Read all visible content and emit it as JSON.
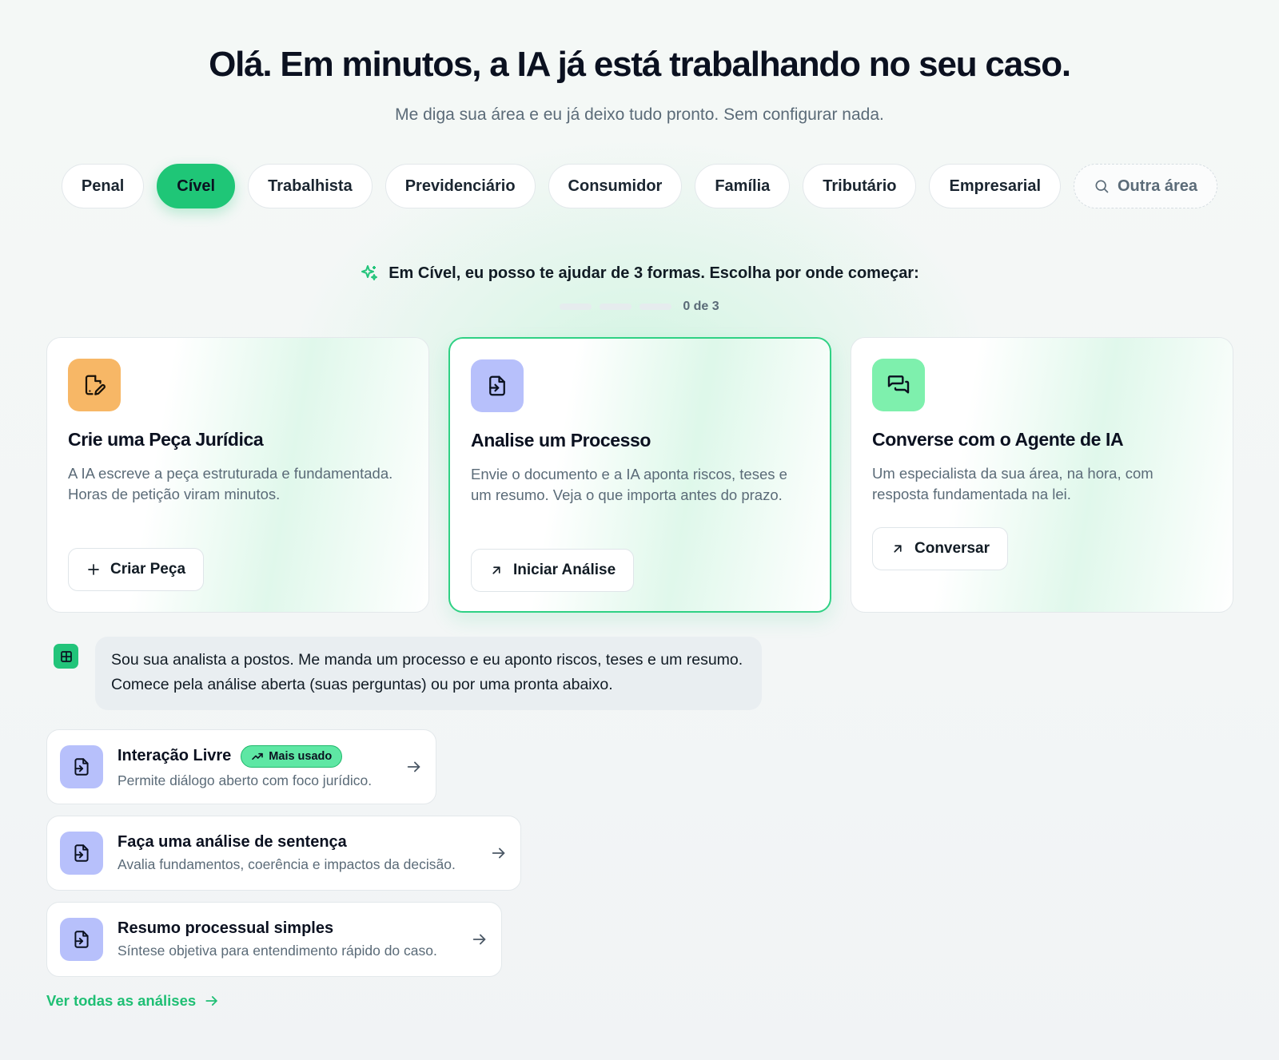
{
  "hero": {
    "title": "Olá. Em minutos, a IA já está trabalhando no seu caso.",
    "subtitle": "Me diga sua área e eu já deixo tudo pronto. Sem configurar nada."
  },
  "areas": {
    "items": [
      "Penal",
      "Cível",
      "Trabalhista",
      "Previdenciário",
      "Consumidor",
      "Família",
      "Tributário",
      "Empresarial"
    ],
    "active": "Cível",
    "other_label": "Outra área"
  },
  "prompt": {
    "text": "Em Cível, eu posso te ajudar de 3 formas. Escolha por onde começar:",
    "progress_label": "0 de 3",
    "progress_value": 0,
    "progress_total": 3
  },
  "cards": [
    {
      "title": "Crie uma Peça Jurídica",
      "description": "A IA escreve a peça estruturada e fundamentada. Horas de petição viram minutos.",
      "button": "Criar Peça",
      "icon": "file-edit-icon",
      "icon_color": "#f7b766"
    },
    {
      "title": "Analise um Processo",
      "description": "Envie o documento e a IA aponta riscos, teses e um resumo. Veja o que importa antes do prazo.",
      "button": "Iniciar Análise",
      "icon": "file-import-icon",
      "icon_color": "#b7c0fb"
    },
    {
      "title": "Converse com o Agente de IA",
      "description": "Um especialista da sua área, na hora, com resposta fundamentada na lei.",
      "button": "Conversar",
      "icon": "chat-icon",
      "icon_color": "#7ef0ad"
    }
  ],
  "assistant": {
    "message": "Sou sua analista a postos. Me manda um processo e eu aponto riscos, teses e um resumo. Comece pela análise aberta (suas perguntas) ou por uma pronta abaixo."
  },
  "analyses": [
    {
      "title": "Interação Livre",
      "badge": "Mais usado",
      "subtitle": "Permite diálogo aberto com foco jurídico."
    },
    {
      "title": "Faça uma análise de sentença",
      "subtitle": "Avalia fundamentos, coerência e impactos da decisão."
    },
    {
      "title": "Resumo processual simples",
      "subtitle": "Síntese objetiva para entendimento rápido do caso."
    }
  ],
  "see_all": "Ver todas as análises",
  "colors": {
    "accent": "#1fc677",
    "accent_text": "#1fbf74",
    "card_highlight_border": "#2fd184"
  }
}
